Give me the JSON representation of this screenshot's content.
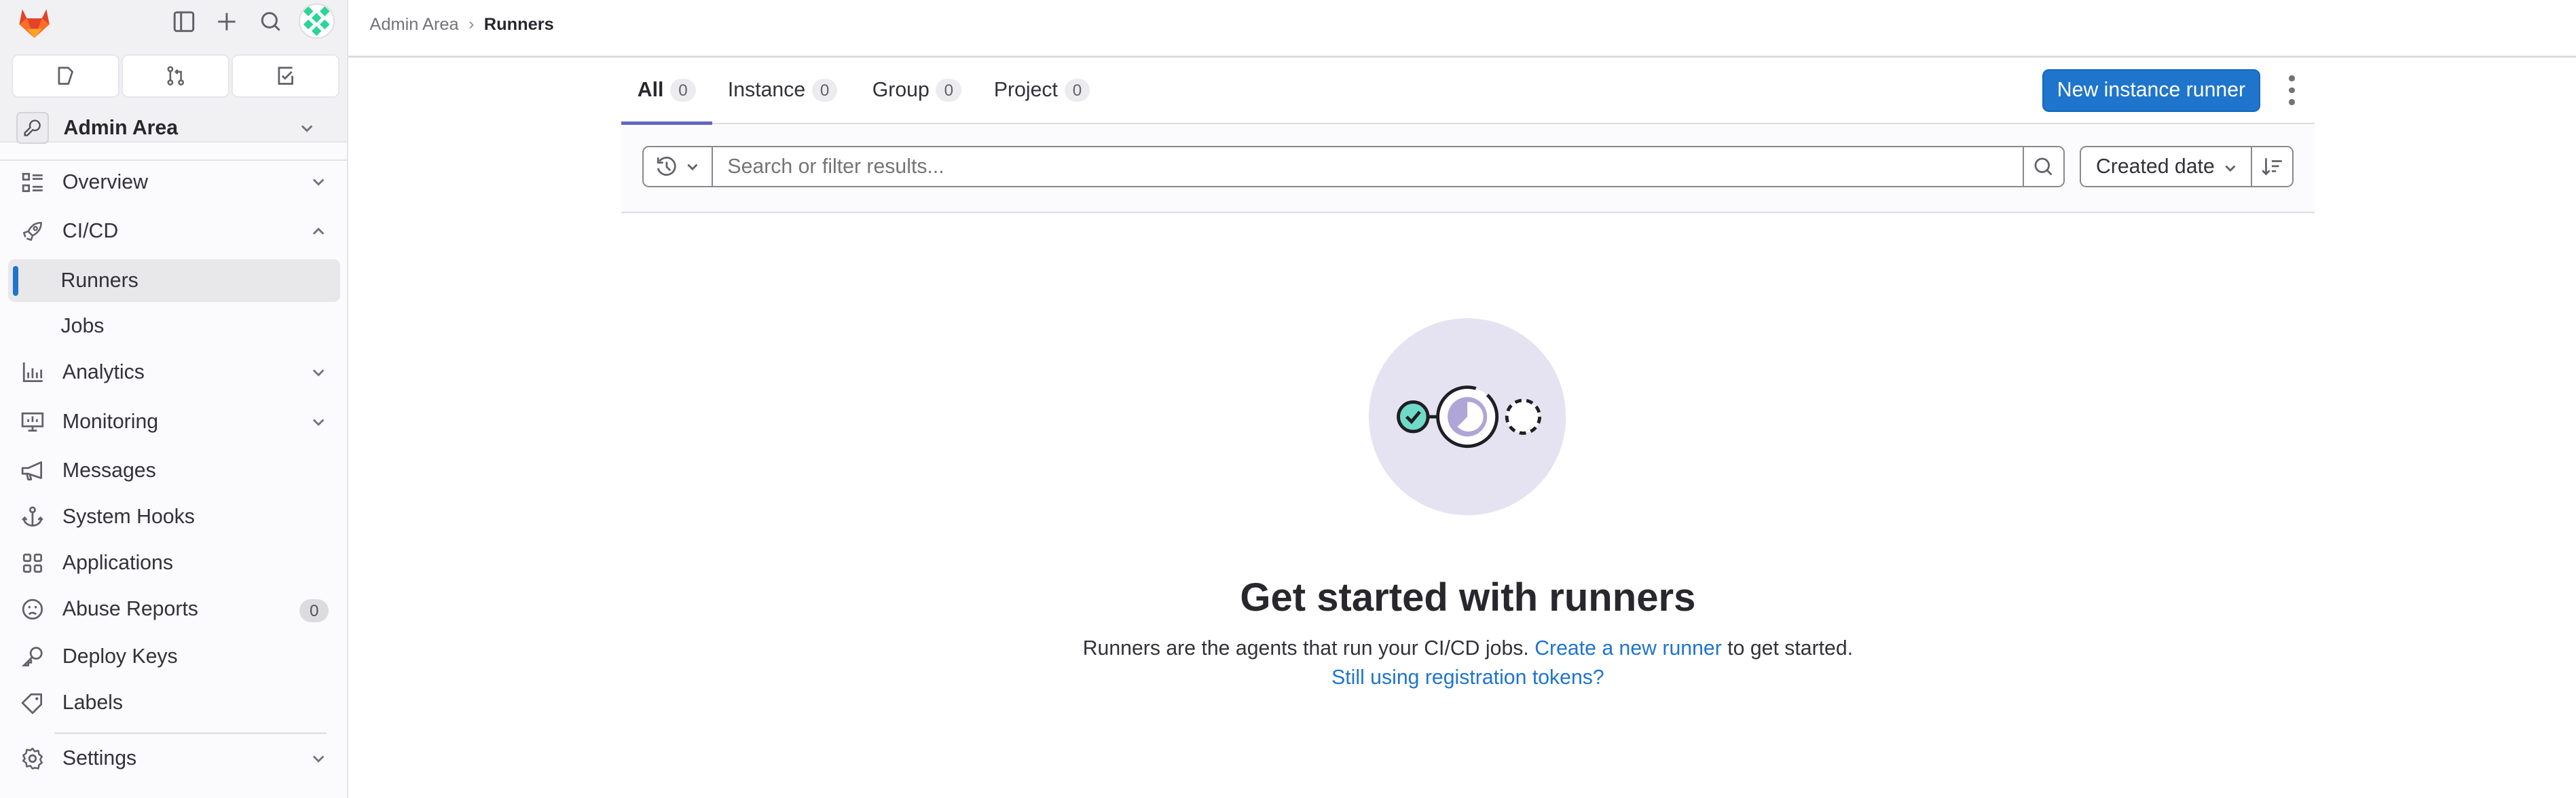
{
  "sidebar": {
    "quick_actions": [
      {
        "name": "issues",
        "icon": "issues-icon"
      },
      {
        "name": "merge-requests",
        "icon": "merge-request-icon"
      },
      {
        "name": "todos",
        "icon": "todo-icon"
      }
    ],
    "context_title": "Admin Area",
    "items": [
      {
        "label": "Overview",
        "icon": "overview-icon",
        "expandable": true
      },
      {
        "label": "CI/CD",
        "icon": "rocket-icon",
        "expanded": true
      },
      {
        "label": "Runners",
        "active": true
      },
      {
        "label": "Jobs"
      },
      {
        "label": "Analytics",
        "icon": "chart-icon",
        "expandable": true
      },
      {
        "label": "Monitoring",
        "icon": "monitor-icon",
        "expandable": true
      },
      {
        "label": "Messages",
        "icon": "megaphone-icon"
      },
      {
        "label": "System Hooks",
        "icon": "anchor-icon"
      },
      {
        "label": "Applications",
        "icon": "grid-icon"
      },
      {
        "label": "Abuse Reports",
        "icon": "sad-face-icon",
        "count": "0"
      },
      {
        "label": "Deploy Keys",
        "icon": "key-icon"
      },
      {
        "label": "Labels",
        "icon": "label-icon"
      },
      {
        "label": "Settings",
        "icon": "gear-icon",
        "expandable": true
      }
    ]
  },
  "breadcrumb": {
    "parent": "Admin Area",
    "current": "Runners"
  },
  "tabs": [
    {
      "label": "All",
      "count": "0",
      "active": true
    },
    {
      "label": "Instance",
      "count": "0"
    },
    {
      "label": "Group",
      "count": "0"
    },
    {
      "label": "Project",
      "count": "0"
    }
  ],
  "actions": {
    "new_runner": "New instance runner"
  },
  "filter": {
    "placeholder": "Search or filter results...",
    "sort_label": "Created date"
  },
  "empty_state": {
    "title": "Get started with runners",
    "description_prefix": "Runners are the agents that run your CI/CD jobs. ",
    "create_link": "Create a new runner",
    "description_suffix": " to get started.",
    "tokens_link": "Still using registration tokens?"
  },
  "colors": {
    "primary": "#1f75cb",
    "tab_active": "#6666c4",
    "illustration_bg": "#e5e3f1",
    "success": "#6fdac8",
    "illustration_accent": "#afa5d6"
  }
}
